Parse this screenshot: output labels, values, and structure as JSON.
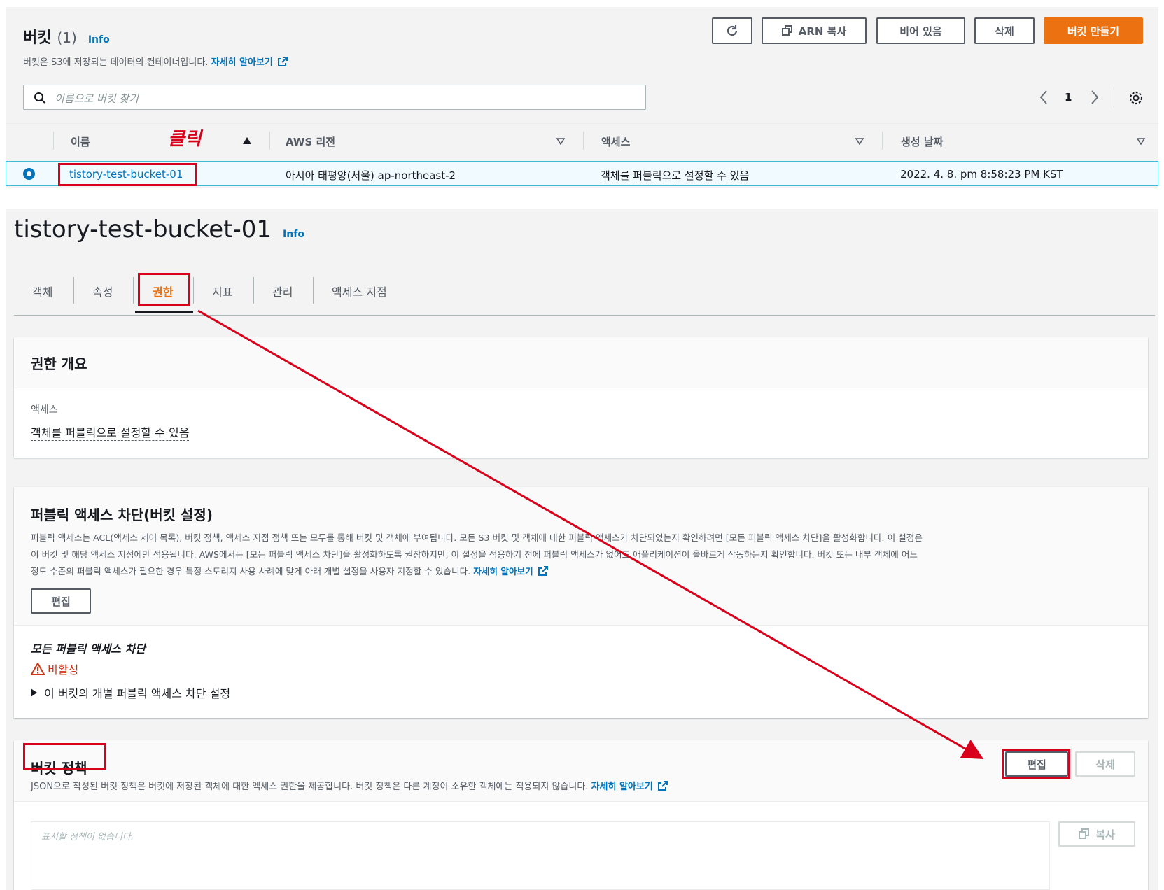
{
  "buckets": {
    "title": "버킷",
    "count": "(1)",
    "info_link": "Info",
    "description": "버킷은 S3에 저장되는 데이터의 컨테이너입니다.",
    "learn_more": "자세히 알아보기",
    "buttons": {
      "copy_arn": "ARN 복사",
      "empty": "비어 있음",
      "delete": "삭제",
      "create": "버킷 만들기"
    },
    "search_placeholder": "이름으로 버킷 찾기",
    "page": "1",
    "columns": {
      "name": "이름",
      "region": "AWS 리전",
      "access": "액세스",
      "created": "생성 날짜"
    },
    "rows": [
      {
        "name": "tistory-test-bucket-01",
        "region": "아시아 태평양(서울) ap-northeast-2",
        "access": "객체를 퍼블릭으로 설정할 수 있음",
        "created": "2022. 4. 8. pm 8:58:23 PM KST"
      }
    ]
  },
  "annotation": {
    "click_label": "클릭",
    "color": "#d9001b"
  },
  "detail": {
    "bucket_name": "tistory-test-bucket-01",
    "info_link": "Info",
    "tabs": [
      "객체",
      "속성",
      "권한",
      "지표",
      "관리",
      "액세스 지점"
    ],
    "active_tab": "권한",
    "overview": {
      "title": "권한 개요",
      "access_label": "액세스",
      "access_value": "객체를 퍼블릭으로 설정할 수 있음"
    },
    "block_public": {
      "title": "퍼블릭 액세스 차단(버킷 설정)",
      "description_line1": "퍼블릭 액세스는 ACL(액세스 제어 목록), 버킷 정책, 액세스 지점 정책 또는 모두를 통해 버킷 및 객체에 부여됩니다. 모든 S3 버킷 및 객체에 대한 퍼블릭 액세스가 차단되었는지 확인하려면 [모든 퍼블릭 액세스 차단]을 활성화합니다. 이 설정은",
      "description_line2": "이 버킷 및 해당 액세스 지점에만 적용됩니다. AWS에서는 [모든 퍼블릭 액세스 차단]을 활성화하도록 권장하지만, 이 설정을 적용하기 전에 퍼블릭 액세스가 없어도 애플리케이션이 올바르게 작동하는지 확인합니다. 버킷 또는 내부 객체에 어느",
      "description_line3": "정도 수준의 퍼블릭 액세스가 필요한 경우 특정 스토리지 사용 사례에 맞게 아래 개별 설정을 사용자 지정할 수 있습니다.",
      "learn_more": "자세히 알아보기",
      "edit_button": "편집",
      "all_block_label": "모든 퍼블릭 액세스 차단",
      "status": "비활성",
      "status_color": "#d13212",
      "expand_label": "이 버킷의 개별 퍼블릭 액세스 차단 설정"
    },
    "bucket_policy": {
      "title": "버킷 정책",
      "description": "JSON으로 작성된 버킷 정책은 버킷에 저장된 객체에 대한 액세스 권한을 제공합니다. 버킷 정책은 다른 계정이 소유한 객체에는 적용되지 않습니다.",
      "learn_more": "자세히 알아보기",
      "edit_button": "편집",
      "delete_button": "삭제",
      "empty_text": "표시할 정책이 없습니다.",
      "copy_button": "복사"
    }
  }
}
